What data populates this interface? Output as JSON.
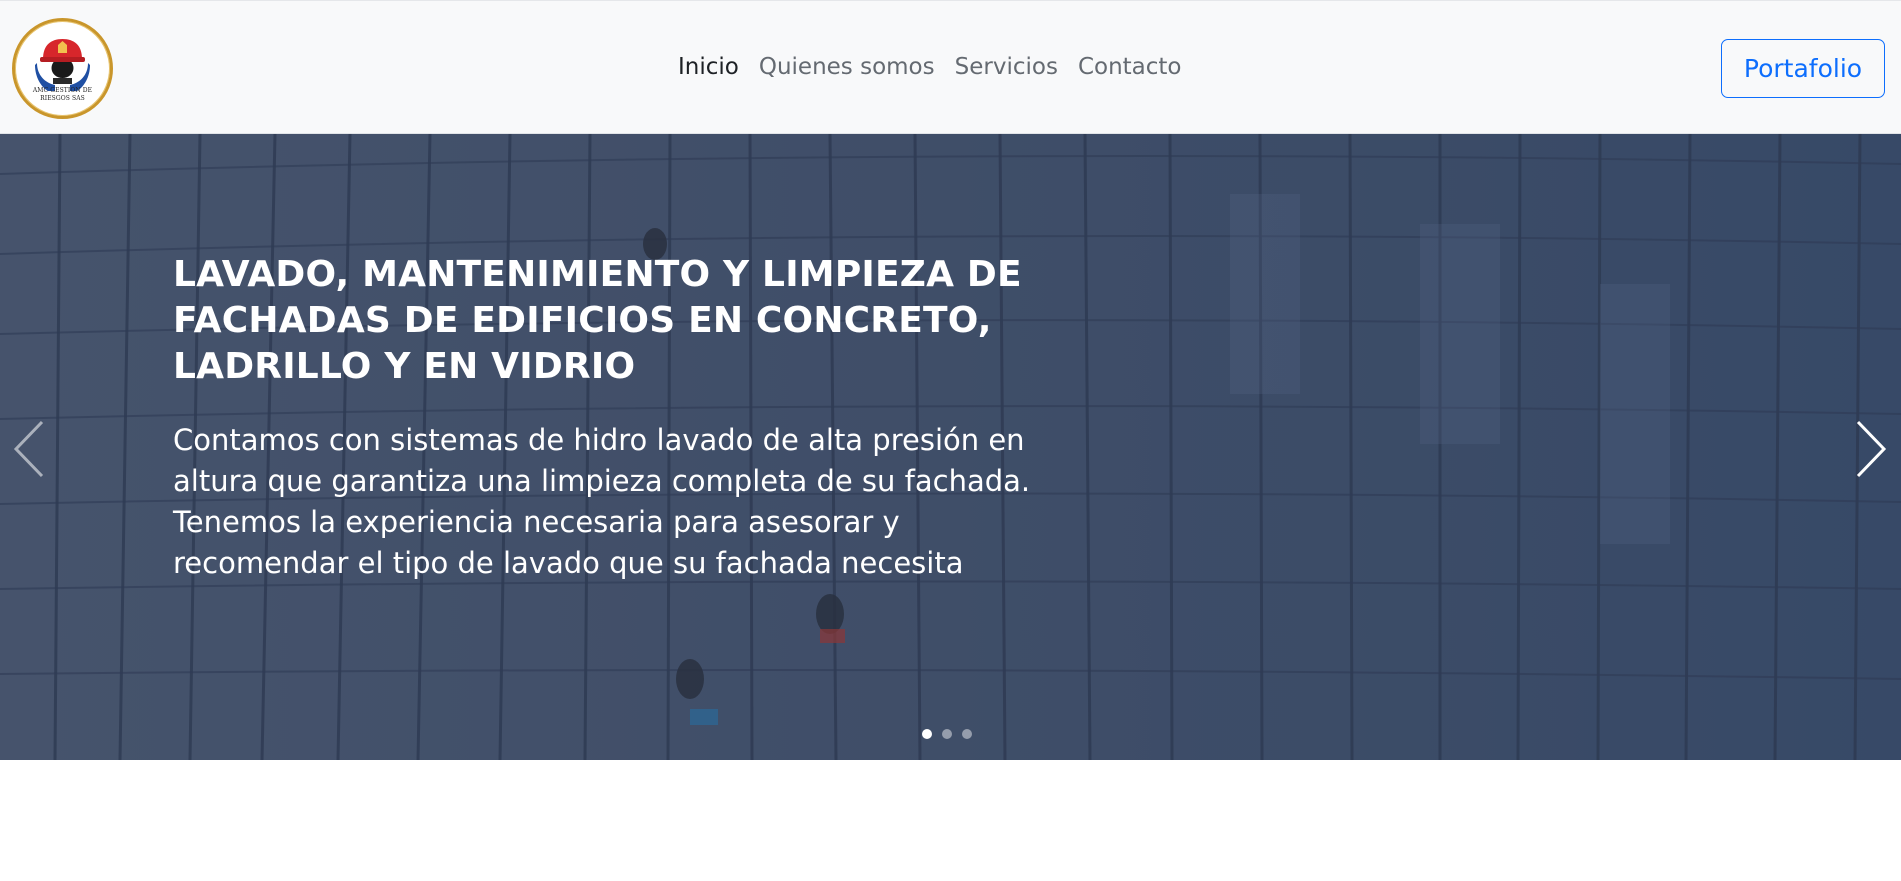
{
  "brand": {
    "logo_text": "AMC GESTION DE RIESGOS SAS",
    "colors": {
      "ring": "#c9962b",
      "helmet": "#d7262b",
      "hands": "#1f4fa3"
    }
  },
  "nav": {
    "items": [
      {
        "label": "Inicio",
        "active": true
      },
      {
        "label": "Quienes somos",
        "active": false
      },
      {
        "label": "Servicios",
        "active": false
      },
      {
        "label": "Contacto",
        "active": false
      }
    ],
    "cta_label": "Portafolio",
    "cta_color": "#0d6efd"
  },
  "carousel": {
    "slide_title": "LAVADO, MANTENIMIENTO Y LIMPIEZA DE FACHADAS DE EDIFICIOS EN CONCRETO, LADRILLO Y EN VIDRIO",
    "slide_text": "Contamos con sistemas de hidro lavado de alta presión en altura que garantiza una limpieza completa de su fachada. Tenemos la experiencia necesaria para asesorar y recomendar el tipo de lavado que su fachada necesita",
    "prev_icon": "chevron-left-icon",
    "next_icon": "chevron-right-icon",
    "slide_count": 3,
    "active_slide": 1
  }
}
